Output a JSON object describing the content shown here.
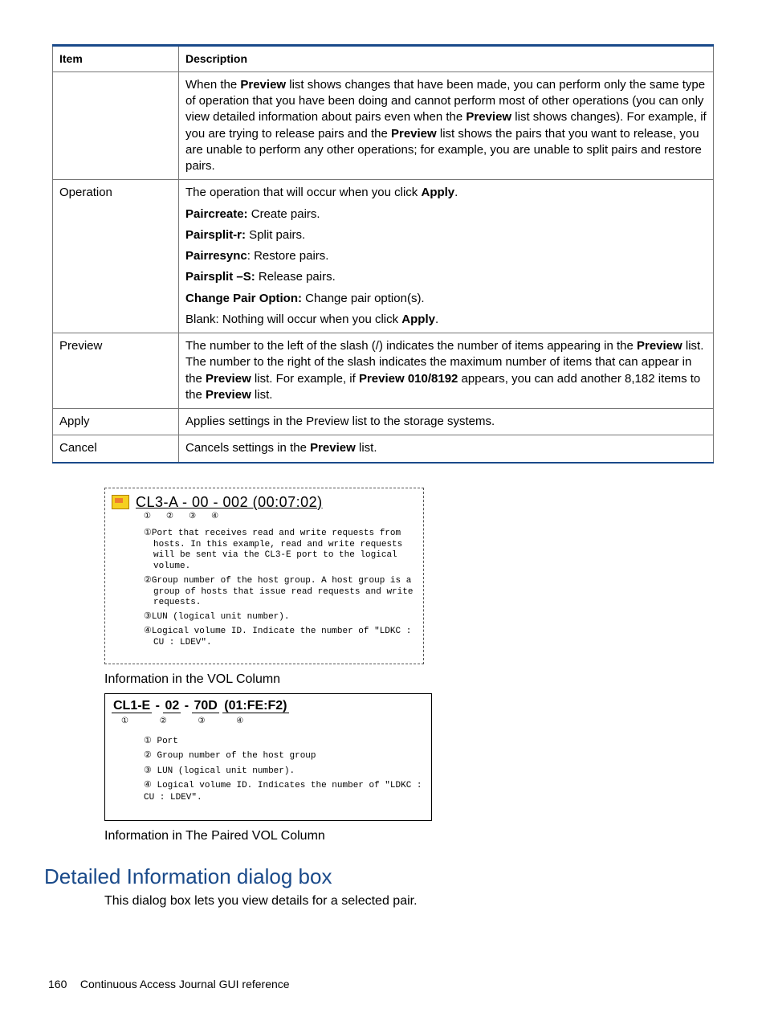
{
  "table": {
    "head_item": "Item",
    "head_desc": "Description",
    "row0_desc_part1": "When the ",
    "row0_bold1": "Preview",
    "row0_desc_part2": " list shows changes that have been made, you can perform only the same type of operation that you have been doing and cannot perform most of other operations (you can only view detailed information about pairs even when the ",
    "row0_bold2": "Preview",
    "row0_desc_part3": " list shows changes). For example, if you are trying to release pairs and the ",
    "row0_bold3": "Preview",
    "row0_desc_part4": " list shows the pairs that you want to release, you are unable to perform any other operations; for example, you are unable to split pairs and restore pairs.",
    "row1_item": "Operation",
    "row1_intro1": "The operation that will occur when you click ",
    "row1_apply": "Apply",
    "row1_intro2": ".",
    "row1_l1b": "Paircreate:",
    "row1_l1t": " Create pairs.",
    "row1_l2b": "Pairsplit-r:",
    "row1_l2t": " Split pairs.",
    "row1_l3b": "Pairresync",
    "row1_l3t": ": Restore pairs.",
    "row1_l4b": "Pairsplit –S:",
    "row1_l4t": " Release pairs.",
    "row1_l5b": "Change Pair Option:",
    "row1_l5t": " Change pair option(s).",
    "row1_l6a": "Blank: Nothing will occur when you click ",
    "row1_l6b": "Apply",
    "row1_l6c": ".",
    "row2_item": "Preview",
    "row2_p1": "The number to the left of the slash (/) indicates the number of items appearing in the ",
    "row2_b1": "Preview",
    "row2_p2": " list. The number to the right of the slash indicates the maximum number of items that can appear in the ",
    "row2_b2": "Preview",
    "row2_p3": " list. For example, if ",
    "row2_b3": "Preview 010/8192",
    "row2_p4": " appears, you can add another 8,182 items to the ",
    "row2_b4": "Preview",
    "row2_p5": " list.",
    "row3_item": "Apply",
    "row3_desc": "Applies settings in the Preview list to the storage systems.",
    "row4_item": "Cancel",
    "row4_p1": "Cancels settings in the ",
    "row4_b1": "Preview",
    "row4_p2": " list."
  },
  "fig1": {
    "title": "CL3-A - 00 - 002 (00:07:02)",
    "sup1": "①",
    "sup2": "②",
    "sup3": "③",
    "sup4": "④",
    "n1": "①Port that receives read and write requests from hosts. In this example, read and write requests will be sent via the CL3-E port to the logical volume.",
    "n2": "②Group number of the host group. A host group is a group of hosts that issue read requests and write requests.",
    "n3": "③LUN (logical unit number).",
    "n4": "④Logical volume ID. Indicate the number of \"LDKC : CU : LDEV\"."
  },
  "caption1": "Information in the VOL Column",
  "fig2": {
    "seg1": "CL1-E",
    "seg2": "02",
    "seg3": "70D",
    "seg4": "(01:FE:F2)",
    "sup1": "①",
    "sup2": "②",
    "sup3": "③",
    "sup4": "④",
    "n1": "① Port",
    "n2": "② Group number of the host group",
    "n3": "③ LUN (logical unit number).",
    "n4": "④ Logical volume ID. Indicates the number of \"LDKC : CU : LDEV\"."
  },
  "caption2": "Information in The Paired VOL Column",
  "section_heading": "Detailed Information dialog box",
  "section_body": "This dialog box lets you view details for a selected pair.",
  "footer_page": "160",
  "footer_text": "Continuous Access Journal GUI reference"
}
